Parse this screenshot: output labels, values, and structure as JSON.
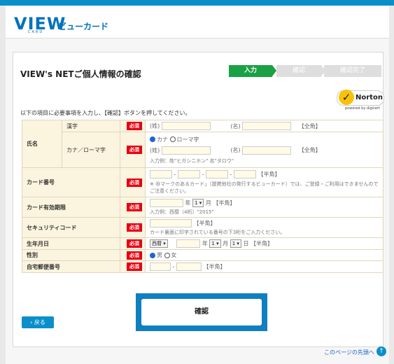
{
  "brand": {
    "logo": "VIEW",
    "logo_sub": "CARD",
    "logo_jp": "ビューカード"
  },
  "page_title": "VIEW's NETご個人情報の確認",
  "steps": [
    "入力",
    "確認",
    "確認完了"
  ],
  "norton": {
    "name": "Norton",
    "sub": "powered by digicert"
  },
  "instruction": "以下の項目に必要事項を入力し、【確認】ボタンを押してください。",
  "required_label": "必須",
  "fields": {
    "name_label": "氏名",
    "kanji_label": "漢字",
    "kana_label": "カナ／ローマ字",
    "sei": "(姓)",
    "mei": "(名)",
    "zenkaku": "【全角】",
    "kana_opt": "カナ",
    "roman_opt": "ローマ字",
    "name_example": "入力例：姓\"ヒガシニホン\" 名\"タロウ\"",
    "card_label": "カード番号",
    "dash": "-",
    "hankaku": "【半角】",
    "card_note": "※ ⓾マークのあるカード」（提携他社の発行するビューカード）では、ご登録・ご利用はできませんのでご注意ください。",
    "expiry_label": "カード有効期限",
    "year": "年",
    "month": "月",
    "expiry_month": "1",
    "expiry_example": "入力例：西暦（4桁）\"2015\"",
    "security_label": "セキュリティコード",
    "security_note": "カード裏面に印字されている番号の下3桁をご入力ください。",
    "birth_label": "生年月日",
    "era": "西暦",
    "birth_month": "1",
    "birth_day": "1",
    "day": "日",
    "gender_label": "性別",
    "male": "男",
    "female": "女",
    "postal_label": "自宅郵便番号"
  },
  "buttons": {
    "back": "戻る",
    "confirm": "確認"
  },
  "footer": {
    "to_top": "このページの先頭へ"
  }
}
